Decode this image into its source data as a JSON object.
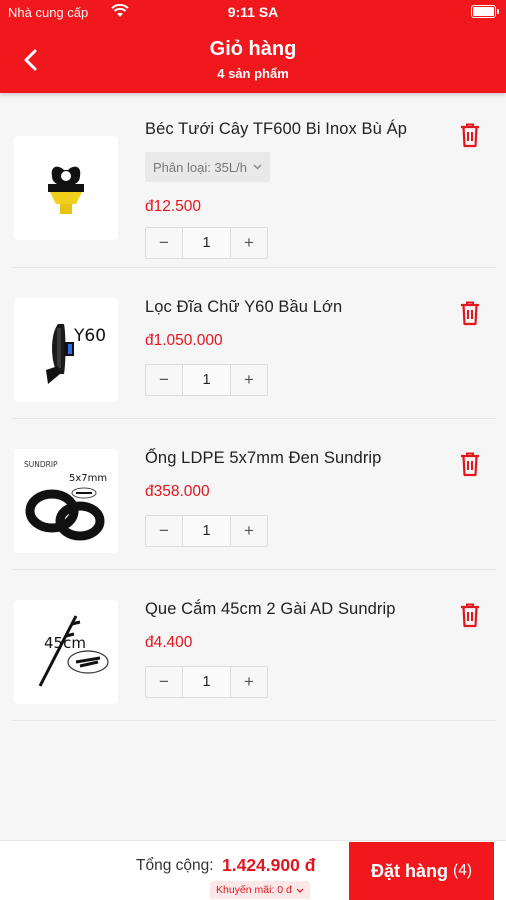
{
  "status_bar": {
    "carrier": "Nhà cung cấp",
    "time": "9:11 SA"
  },
  "nav": {
    "title": "Giỏ hàng",
    "subtitle": "4 sản phẩm"
  },
  "items": [
    {
      "name": "Béc Tưới Cây TF600 Bi Inox Bù Áp",
      "variant": "Phân loại: 35L/h",
      "price": "đ12.500",
      "quantity": "1",
      "minus": "−",
      "plus": "+"
    },
    {
      "name": "Lọc Đĩa Chữ Y60 Bầu Lớn",
      "price": "đ1.050.000",
      "quantity": "1",
      "minus": "−",
      "plus": "+",
      "image_text": "Y60"
    },
    {
      "name": "Ống LDPE 5x7mm Đen Sundrip",
      "price": "đ358.000",
      "quantity": "1",
      "minus": "−",
      "plus": "+",
      "image_text": "SUNDRIP",
      "image_text_2": "5x7mm"
    },
    {
      "name": "Que Cắm 45cm 2 Gài AD Sundrip",
      "price": "đ4.400",
      "quantity": "1",
      "minus": "−",
      "plus": "+",
      "image_text": "45cm"
    }
  ],
  "footer": {
    "total_label": "Tổng cộng:",
    "total_value": "1.424.900 đ",
    "promo_label": "Khuyến mãi: 0 đ",
    "order_label": "Đặt hàng",
    "order_count": "(4)"
  },
  "colors": {
    "primary": "#f0171d",
    "price": "#e3161e"
  },
  "icons": [
    "wifi-icon",
    "battery-icon",
    "back-arrow-icon",
    "trash-icon",
    "chevron-down-icon"
  ]
}
